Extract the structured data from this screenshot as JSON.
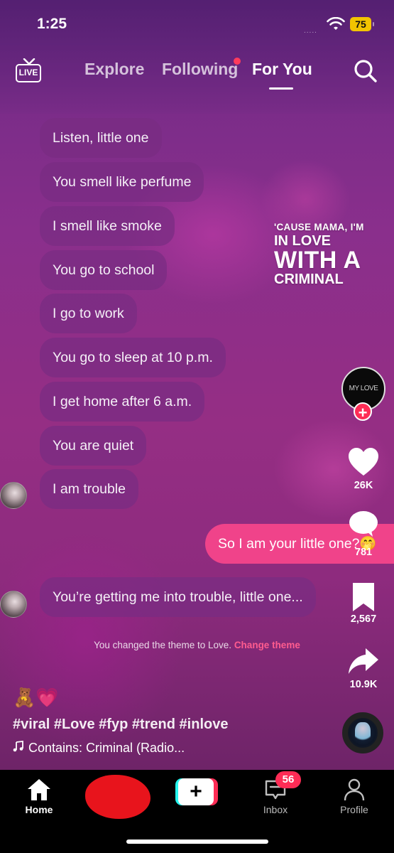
{
  "status_bar": {
    "time": "1:25",
    "battery": "75",
    "wifi_icon": "wifi-icon",
    "signal": "....."
  },
  "top_nav": {
    "live_label": "LIVE",
    "tabs": [
      {
        "label": "Explore"
      },
      {
        "label": "Following",
        "has_dot": true
      },
      {
        "label": "For You",
        "active": true
      }
    ],
    "search_icon": "search-icon"
  },
  "chat": {
    "messages": [
      {
        "text": "Listen, little one"
      },
      {
        "text": "You smell like perfume"
      },
      {
        "text": "I smell like smoke"
      },
      {
        "text": "You go to school"
      },
      {
        "text": "I go to work"
      },
      {
        "text": "You go to sleep at 10 p.m."
      },
      {
        "text": "I get home after 6 a.m."
      },
      {
        "text": "You are quiet"
      },
      {
        "text": "I am trouble"
      }
    ],
    "my_message": "So I am your little one?🤭",
    "last_message": "You’re getting me into trouble, little one...",
    "system_note": "You changed the theme to Love.",
    "system_link": "Change theme"
  },
  "lyric_overlay": {
    "line1": "'CAUSE MAMA, I'M",
    "line2": "IN LOVE",
    "line3": "WITH A",
    "line4": "CRIMINAL"
  },
  "right_rail": {
    "creator_avatar_text": "MY LOVE",
    "likes": "26K",
    "comments": "781",
    "saves": "2,567",
    "shares": "10.9K"
  },
  "caption": {
    "emojis": "🧸💗",
    "hashtags": "#viral #Love #fyp #trend #inlove",
    "music": "Contains: Criminal (Radio..."
  },
  "tab_bar": {
    "home": "Home",
    "inbox": "Inbox",
    "inbox_badge": "56",
    "profile": "Profile"
  },
  "colors": {
    "accent_pink": "#fe2c55",
    "my_bubble": "#f0438a",
    "cyan": "#25f4ee"
  }
}
